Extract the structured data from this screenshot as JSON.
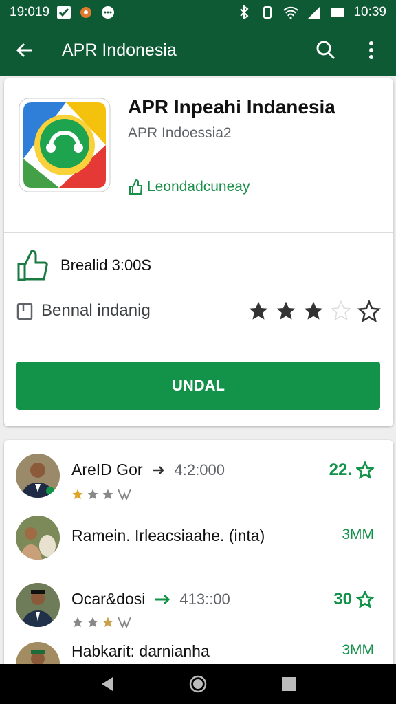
{
  "status_bar": {
    "time_left": "19:019",
    "time_right": "10:39"
  },
  "app_bar": {
    "title": "APR Indonesia"
  },
  "app": {
    "name": "APR Inpeahi Indanesia",
    "developer": "APR Indoessia2",
    "badge": "Leondadcuneay",
    "meta_row": "Brealid 3:00S",
    "category": "Bennal indanig",
    "rating_stars": 3,
    "install_label": "UNDAL"
  },
  "reviews": [
    {
      "name": "AreID Gor",
      "time": "4:2:000",
      "score": "22.",
      "stars": 2
    },
    {
      "name": "Ramein. Irleacsiaahe. (inta)",
      "size": "3MM"
    },
    {
      "name": "Ocar&dosi",
      "time": "413::00",
      "score": "30",
      "stars": 2
    },
    {
      "name": "Habkarit: darnianha",
      "size": "3MM"
    }
  ],
  "colors": {
    "brand_dark": "#0e5a34",
    "accent_green": "#13934a"
  }
}
